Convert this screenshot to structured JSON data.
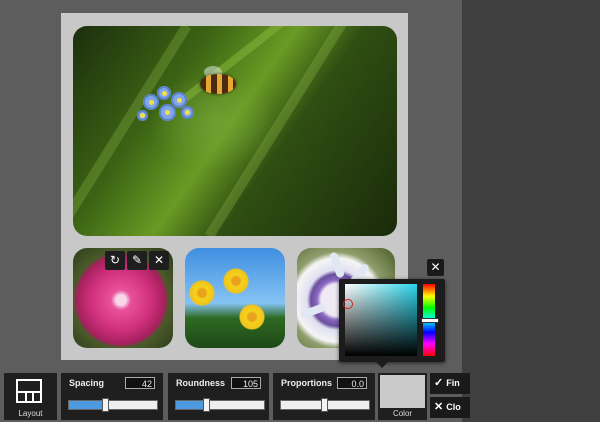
{
  "icons": {
    "thumb_swap": "↻",
    "thumb_edit": "✎",
    "thumb_remove": "✕",
    "picker_close": "✕",
    "finish": "✓",
    "close": "✕"
  },
  "colors": {
    "selected": "#cacaca",
    "picker_hue": "#2ad4ea",
    "slider_fill": "#4c9be0"
  },
  "toolbar": {
    "layout": {
      "label": "Layout"
    },
    "spacing": {
      "title": "Spacing",
      "value": "42",
      "level": 0.42
    },
    "roundness": {
      "title": "Roundness",
      "value": "105",
      "level": 0.35
    },
    "proportions": {
      "title": "Proportions",
      "value": "0.0",
      "level": 0.5
    },
    "color": {
      "label": "Color"
    },
    "finish_label": "Fin",
    "close_label": "Clo"
  }
}
